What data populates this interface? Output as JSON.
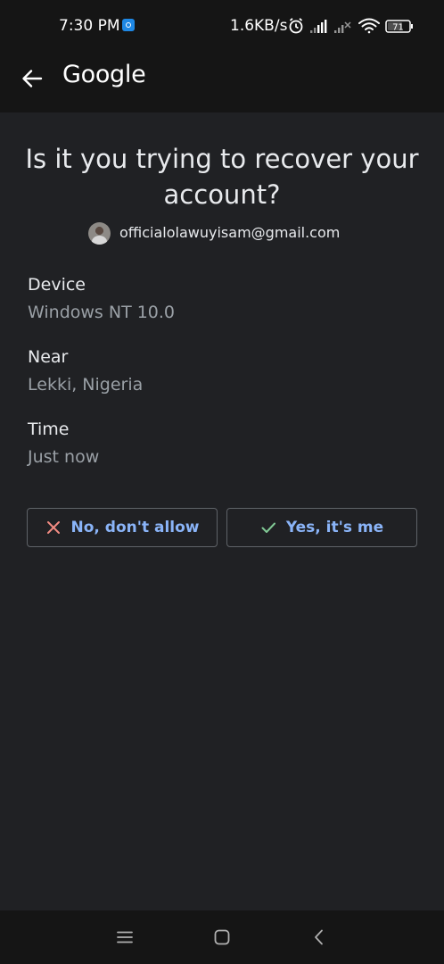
{
  "status_bar": {
    "time": "7:30 PM",
    "speed": "1.6KB/s",
    "battery": "71",
    "icons": [
      "notification-app-icon",
      "alarm-icon",
      "signal-icon",
      "signal-no-service-icon",
      "wifi-icon",
      "battery-icon"
    ]
  },
  "app_bar": {
    "title": "Google",
    "back_icon": "back-arrow-icon"
  },
  "main": {
    "heading": "Is it you trying to recover your account?",
    "account_email": "officialolawuyisam@gmail.com",
    "details": [
      {
        "label": "Device",
        "value": "Windows NT 10.0"
      },
      {
        "label": "Near",
        "value": "Lekki, Nigeria"
      },
      {
        "label": "Time",
        "value": "Just now"
      }
    ],
    "deny_button": {
      "label": "No, don't allow",
      "icon": "close-icon",
      "icon_color": "#f28b82"
    },
    "allow_button": {
      "label": "Yes, it's me",
      "icon": "check-icon",
      "icon_color": "#81c995"
    }
  },
  "nav_bar": {
    "buttons": [
      "menu-icon",
      "home-icon",
      "back-icon"
    ]
  },
  "colors": {
    "background": "#202124",
    "bar_background": "#151515",
    "accent": "#8ab4f8",
    "secondary_text": "#9aa0a6"
  }
}
